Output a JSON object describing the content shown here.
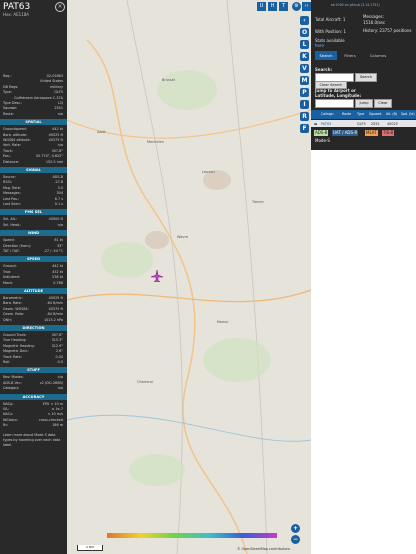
{
  "aircraft": {
    "callsign": "PAT63",
    "hex_line": "Hex: AE118A",
    "close_icon": "close-icon"
  },
  "details": [
    {
      "k": "Reg.:",
      "v": "02-01863"
    },
    {
      "k": "",
      "v": "United States"
    },
    {
      "k": "DB flags:",
      "v": "military"
    },
    {
      "k": "Type:",
      "v": "GLF5"
    },
    {
      "k": "",
      "v": "Gulfstream Aerospace C-37A"
    },
    {
      "k": "Type Desc.:",
      "v": "L2J"
    },
    {
      "k": "Squawk:",
      "v": "2551"
    },
    {
      "k": "Route:",
      "v": "n/a"
    }
  ],
  "sections": {
    "spatial": "SPATIAL",
    "signal": "SIGNAL",
    "fms": "FMS SEL",
    "wind": "WIND",
    "speed": "SPEED",
    "altitude": "ALTITUDE",
    "direction": "DIRECTION",
    "stuff": "STUFF",
    "accuracy": "ACCURACY"
  },
  "spatial_rows": [
    {
      "k": "Groundspeed:",
      "v": "442 kt"
    },
    {
      "k": "Baro. altitude:",
      "v": "40025 ft"
    },
    {
      "k": "WGS84 altitude:",
      "v": "40375 ft"
    },
    {
      "k": "Vert. Rate:",
      "v": "n/a"
    },
    {
      "k": "Track:",
      "v": "307.8°"
    },
    {
      "k": "Pos.:",
      "v": "50.770°, 4.622°"
    },
    {
      "k": "Distance:",
      "v": "152.5 nmi"
    }
  ],
  "signal_rows": [
    {
      "k": "Source:",
      "v": "ADS-B"
    },
    {
      "k": "RSSI:",
      "v": "-27.8"
    },
    {
      "k": "Msg. Rate:",
      "v": "3.0"
    },
    {
      "k": "Messages:",
      "v": "304"
    },
    {
      "k": "Last Pos.:",
      "v": "6.7 s"
    },
    {
      "k": "Last Seen:",
      "v": "0.1 s"
    }
  ],
  "fms_rows": [
    {
      "k": "Sel. Alt.:",
      "v": "40000 ft"
    },
    {
      "k": "Sel. Head.:",
      "v": "n/a"
    }
  ],
  "wind_rows": [
    {
      "k": "Speed:",
      "v": "61 kt"
    },
    {
      "k": "Direction (from):",
      "v": "33°"
    },
    {
      "k": "TAT / OAT:",
      "v": "-27 / -54 °C"
    }
  ],
  "speed_rows": [
    {
      "k": "Ground:",
      "v": "442 kt"
    },
    {
      "k": "True:",
      "v": "452 kt"
    },
    {
      "k": "Indicated:",
      "v": "238 kt"
    },
    {
      "k": "Mach:",
      "v": "0.788"
    }
  ],
  "altitude_rows": [
    {
      "k": "Barometric:",
      "v": "40025 ft"
    },
    {
      "k": "Baro. Rate:",
      "v": "-64 ft/min"
    },
    {
      "k": "Geom. WGS84:",
      "v": "40375 ft"
    },
    {
      "k": "Geom. Rate:",
      "v": "-64 ft/min"
    },
    {
      "k": "QNH:",
      "v": "1013.2 hPa"
    }
  ],
  "direction_rows": [
    {
      "k": "Ground Track:",
      "v": "307.8°"
    },
    {
      "k": "True Heading:",
      "v": "315.3°"
    },
    {
      "k": "Magnetic Heading:",
      "v": "312.9°"
    },
    {
      "k": "Magnetic Decl.:",
      "v": "2.6°"
    },
    {
      "k": "Track Rate:",
      "v": "0.00"
    },
    {
      "k": "Roll:",
      "v": "-0.5"
    }
  ],
  "stuff_rows": [
    {
      "k": "Nav. Modes:",
      "v": "n/a"
    },
    {
      "k": "ADS-B Ver.:",
      "v": "v2 (DO-260B)"
    },
    {
      "k": "Category:",
      "v": "n/a"
    }
  ],
  "accuracy_rows": [
    {
      "k": "NACp:",
      "v": "EPU < 10 m"
    },
    {
      "k": "SIL:",
      "v": "≤ 1e-7"
    },
    {
      "k": "NACv:",
      "v": "< 10 m/s"
    },
    {
      "k": "NICbaro:",
      "v": "cross-checked"
    },
    {
      "k": "Rc:",
      "v": "186 m"
    }
  ],
  "footnote": "Learn more about Mode S data types by hovering over each data label.",
  "map": {
    "top_buttons": [
      "U",
      "H",
      "T"
    ],
    "side_buttons": [
      "O",
      "L",
      "K",
      "V",
      "M",
      "P",
      "I",
      "R",
      "F"
    ],
    "towns": [
      "Brussel",
      "Leuven",
      "Charleroi",
      "Namur",
      "Tienen",
      "Wavre",
      "Aalst",
      "Mechelen"
    ],
    "scale": "2 NM",
    "attribution": "© OpenStreetMap contributors."
  },
  "right": {
    "top_links": "tar1090 on github (3.14.1791)",
    "stats": {
      "total_label": "Total Aircraft: 1",
      "pos_label": "With Position: 1",
      "avail_label": "Stats available",
      "messages": "Messages:",
      "msg_rate": "1516.0/sec",
      "history": "History: 23757 positions",
      "here": "here"
    },
    "tabs": [
      "Search",
      "Filters",
      "Columns"
    ],
    "search_label": "Search:",
    "search_btn": "Search",
    "clear_btn": "Clear Search",
    "jump_label": "Jump to Airport or Latitude, Longitude:",
    "jump_btn": "Jump",
    "clear2_btn": "Clear",
    "table_headers": [
      "Callsign",
      "Route",
      "Type",
      "Squawk",
      "Alt. (ft)",
      "Spd. (kt)"
    ],
    "table_row": [
      "PAT63",
      "",
      "GLF5",
      "2551",
      "40025",
      ""
    ],
    "legend": [
      "ADS-B",
      "UAT / ADS-R",
      "MLAT",
      "TIS-B",
      "Mode-S"
    ]
  }
}
